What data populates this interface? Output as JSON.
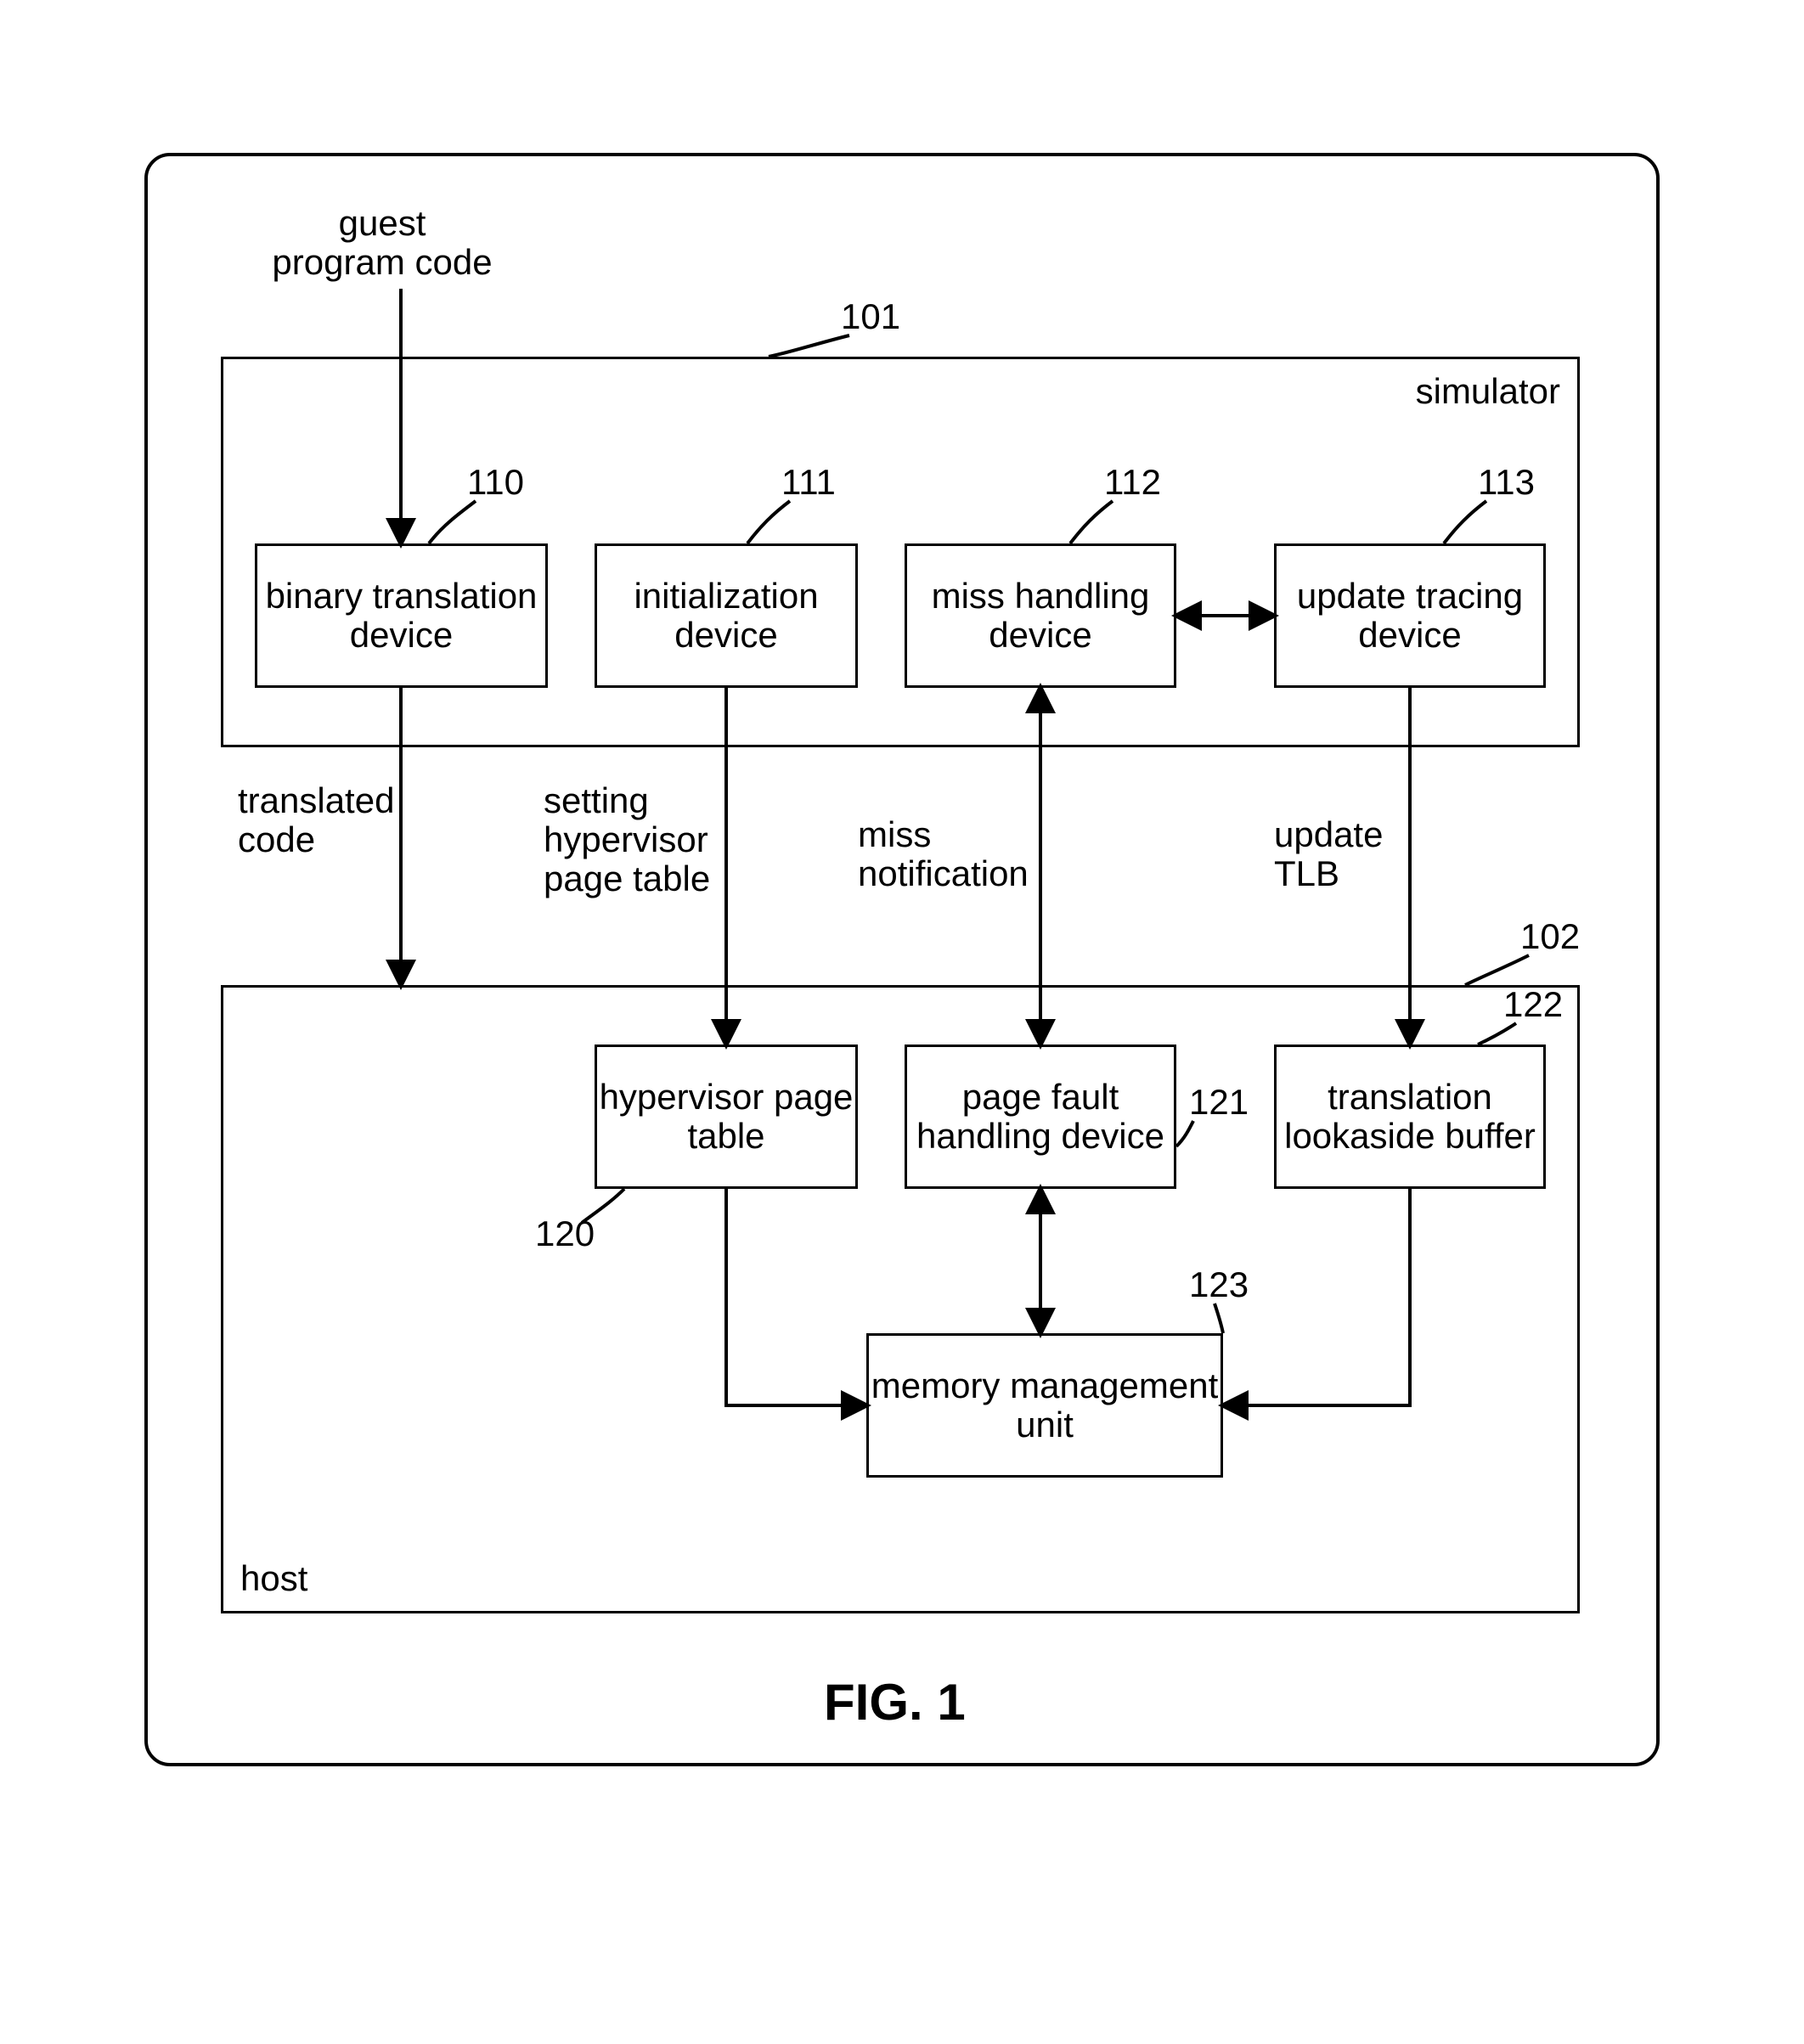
{
  "figure_caption": "FIG. 1",
  "inputs": {
    "guest_program_code": "guest\nprogram code"
  },
  "simulator": {
    "container_label": "simulator",
    "ref": "101",
    "blocks": {
      "binary_translation": {
        "label": "binary translation\ndevice",
        "ref": "110"
      },
      "initialization": {
        "label": "initialization\ndevice",
        "ref": "111"
      },
      "miss_handling": {
        "label": "miss handling\ndevice",
        "ref": "112"
      },
      "update_tracing": {
        "label": "update tracing\ndevice",
        "ref": "113"
      }
    }
  },
  "host": {
    "container_label": "host",
    "ref": "102",
    "blocks": {
      "hypervisor_page_table": {
        "label": "hypervisor\npage table",
        "ref": "120"
      },
      "page_fault": {
        "label": "page fault\nhandling device",
        "ref": "121"
      },
      "tlb": {
        "label": "translation\nlookaside buffer",
        "ref": "122"
      },
      "mmu": {
        "label": "memory\nmanagement unit",
        "ref": "123"
      }
    }
  },
  "edge_labels": {
    "translated_code": "translated\ncode",
    "setting_hypervisor": "setting\nhypervisor\npage table",
    "miss_notification": "miss\nnotification",
    "update_tlb": "update\nTLB"
  }
}
